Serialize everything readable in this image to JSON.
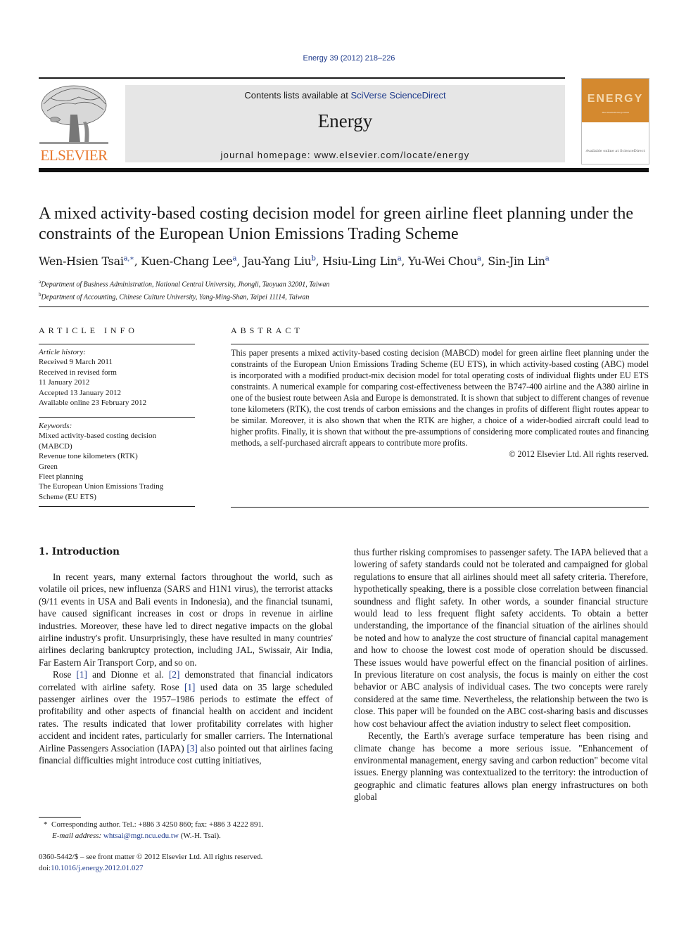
{
  "citation": "Energy 39 (2012) 218–226",
  "header": {
    "contents_prefix": "Contents lists available at ",
    "contents_link": "SciVerse ScienceDirect",
    "journal_name": "Energy",
    "homepage_prefix": "journal homepage: ",
    "homepage_url": "www.elsevier.com/locate/energy",
    "publisher_logo_text": "ELSEVIER",
    "cover_title": "ENERGY",
    "cover_subtitle": "The International Journal",
    "cover_footer": "Available online at ScienceDirect"
  },
  "article": {
    "title": "A mixed activity-based costing decision model for green airline fleet planning under the constraints of the European Union Emissions Trading Scheme",
    "authors": [
      {
        "name": "Wen-Hsien Tsai",
        "sup": "a,∗"
      },
      {
        "name": "Kuen-Chang Lee",
        "sup": "a"
      },
      {
        "name": "Jau-Yang Liu",
        "sup": "b"
      },
      {
        "name": "Hsiu-Ling Lin",
        "sup": "a"
      },
      {
        "name": "Yu-Wei Chou",
        "sup": "a"
      },
      {
        "name": "Sin-Jin Lin",
        "sup": "a"
      }
    ],
    "affiliations": [
      {
        "mark": "a",
        "text": "Department of Business Administration, National Central University, Jhongli, Taoyuan 32001, Taiwan"
      },
      {
        "mark": "b",
        "text": "Department of Accounting, Chinese Culture University, Yang-Ming-Shan, Taipei 11114, Taiwan"
      }
    ]
  },
  "article_info": {
    "heading": "ARTICLE INFO",
    "history_label": "Article history:",
    "history": [
      "Received 9 March 2011",
      "Received in revised form",
      "11 January 2012",
      "Accepted 13 January 2012",
      "Available online 23 February 2012"
    ],
    "keywords_label": "Keywords:",
    "keywords": [
      "Mixed activity-based costing decision",
      "(MABCD)",
      "Revenue tone kilometers (RTK)",
      "Green",
      "Fleet planning",
      "The European Union Emissions Trading",
      "Scheme (EU ETS)"
    ]
  },
  "abstract": {
    "heading": "ABSTRACT",
    "text": "This paper presents a mixed activity-based costing decision (MABCD) model for green airline fleet planning under the constraints of the European Union Emissions Trading Scheme (EU ETS), in which activity-based costing (ABC) model is incorporated with a modified product-mix decision model for total operating costs of individual flights under EU ETS constraints. A numerical example for comparing cost-effectiveness between the B747-400 airline and the A380 airline in one of the busiest route between Asia and Europe is demonstrated. It is shown that subject to different changes of revenue tone kilometers (RTK), the cost trends of carbon emissions and the changes in profits of different flight routes appear to be similar. Moreover, it is also shown that when the RTK are higher, a choice of a wider-bodied aircraft could lead to higher profits. Finally, it is shown that without the pre-assumptions of considering more complicated routes and financing methods, a self-purchased aircraft appears to contribute more profits.",
    "copyright": "© 2012 Elsevier Ltd. All rights reserved."
  },
  "body": {
    "section_title": "1.  Introduction",
    "p1": "In recent years, many external factors throughout the world, such as volatile oil prices, new influenza (SARS and H1N1 virus), the terrorist attacks (9/11 events in USA and Bali events in Indonesia), and the financial tsunami, have caused significant increases in cost or drops in revenue in airline industries. Moreover, these have led to direct negative impacts on the global airline industry's profit. Unsurprisingly, these have resulted in many countries' airlines declaring bankruptcy protection, including JAL, Swissair, Air India, Far Eastern Air Transport Corp, and so on.",
    "p2": {
      "a": "Rose ",
      "ref1": "[1]",
      "b": " and Dionne et al. ",
      "ref2": "[2]",
      "c": " demonstrated that financial indicators correlated with airline safety. Rose ",
      "ref3": "[1]",
      "d": " used data on 35 large scheduled passenger airlines over the 1957–1986 periods to estimate the effect of profitability and other aspects of financial health on accident and incident rates. The results indicated that lower profitability correlates with higher accident and incident rates, particularly for smaller carriers. The International Airline Passengers Association (IAPA) ",
      "ref4": "[3]",
      "e": " also pointed out that airlines facing financial difficulties might introduce cost cutting initiatives,"
    },
    "p3": "thus further risking compromises to passenger safety. The IAPA believed that a lowering of safety standards could not be tolerated and campaigned for global regulations to ensure that all airlines should meet all safety criteria. Therefore, hypothetically speaking, there is a possible close correlation between financial soundness and flight safety. In other words, a sounder financial structure would lead to less frequent flight safety accidents. To obtain a better understanding, the importance of the financial situation of the airlines should be noted and how to analyze the cost structure of financial capital management and how to choose the lowest cost mode of operation should be discussed. These issues would have powerful effect on the financial position of airlines. In previous literature on cost analysis, the focus is mainly on either the cost behavior or ABC analysis of individual cases. The two concepts were rarely considered at the same time. Nevertheless, the relationship between the two is close. This paper will be founded on the ABC cost-sharing basis and discusses how cost behaviour affect the aviation industry to select fleet composition.",
    "p4": "Recently, the Earth's average surface temperature has been rising and climate change has become a more serious issue. \"Enhancement of environmental management, energy saving and carbon reduction\" become vital issues. Energy planning was contextualized to the territory: the introduction of geographic and climatic features allows plan energy infrastructures on both global"
  },
  "footnote": {
    "mark": "*",
    "corresponding": "Corresponding author. Tel.: +886 3 4250 860; fax: +886 3 4222 891.",
    "email_label": "E-mail address:",
    "email": "whtsai@mgt.ncu.edu.tw",
    "email_suffix": " (W.-H. Tsai)."
  },
  "issn": {
    "line1": "0360-5442/$ – see front matter © 2012 Elsevier Ltd. All rights reserved.",
    "doi_prefix": "doi:",
    "doi": "10.1016/j.energy.2012.01.027"
  },
  "colors": {
    "link": "#1f3b8c",
    "elsevier_orange": "#e8762a",
    "cover_orange": "#d4892f",
    "header_gray": "#e6e6e6"
  }
}
